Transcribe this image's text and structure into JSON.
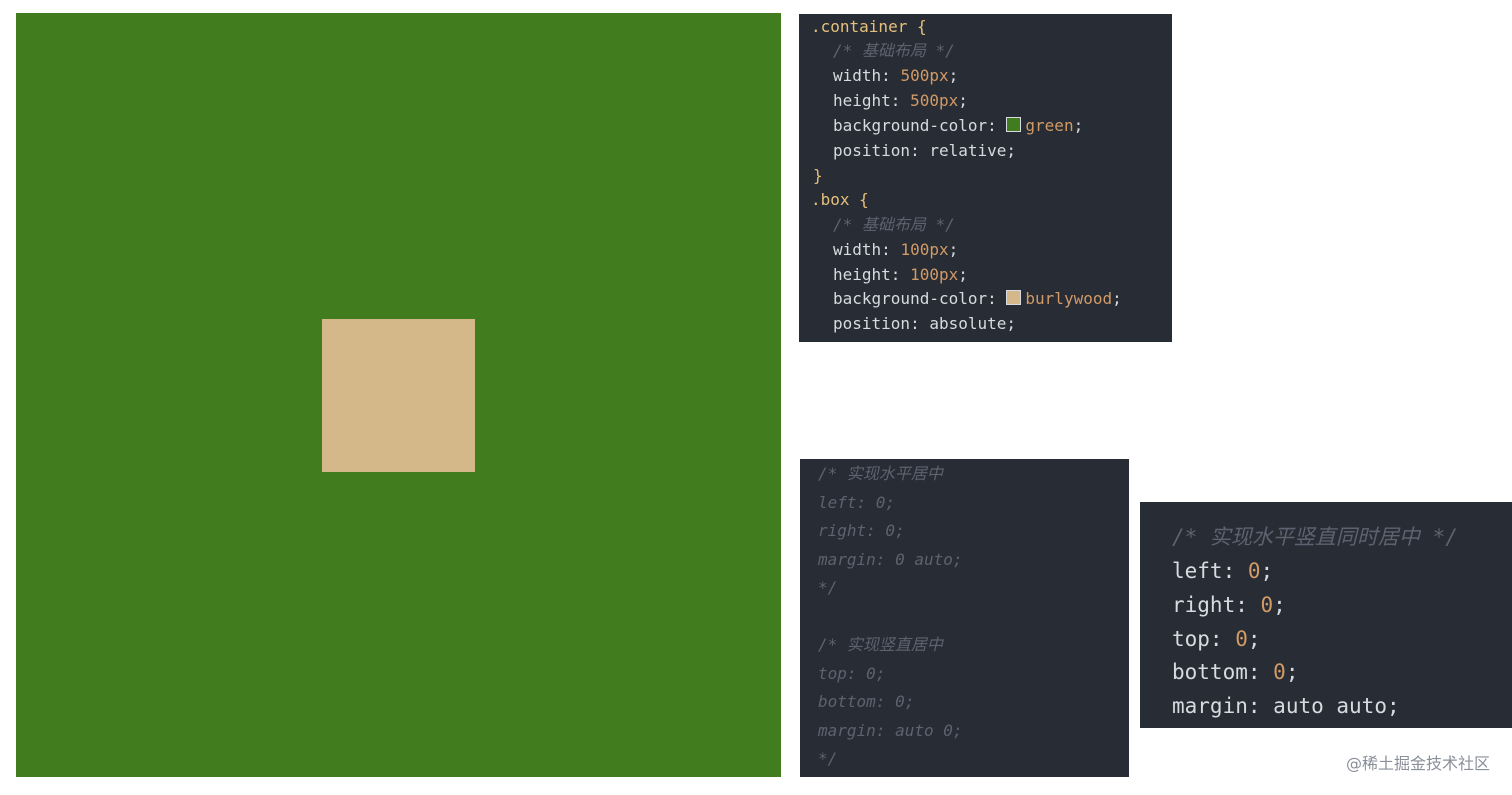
{
  "demo": {
    "container_color": "#417d1f",
    "box_color": "#d4b88a"
  },
  "code_top": {
    "l1": {
      "selector": ".container",
      "brace": " {"
    },
    "l2": {
      "comment": "/* 基础布局 */"
    },
    "l3": {
      "prop": "width:",
      "val": "500px",
      "end": ";"
    },
    "l4": {
      "prop": "height:",
      "val": "500px",
      "end": ";"
    },
    "l5": {
      "prop": "background-color:",
      "swatch": "#417d1f",
      "val": "green",
      "end": ";"
    },
    "l6": {
      "prop": "position:",
      "val": "relative",
      "end": ";"
    },
    "l7": {
      "brace": "}"
    },
    "l8": {
      "selector": ".box",
      "brace": " {"
    },
    "l9": {
      "comment": "/* 基础布局 */"
    },
    "l10": {
      "prop": "width:",
      "val": "100px",
      "end": ";"
    },
    "l11": {
      "prop": "height:",
      "val": "100px",
      "end": ";"
    },
    "l12": {
      "prop": "background-color:",
      "swatch": "#d4b88a",
      "val": "burlywood",
      "end": ";"
    },
    "l13": {
      "prop": "position:",
      "val": "absolute",
      "end": ";"
    }
  },
  "code_bottom": {
    "l1": "/* 实现水平居中",
    "l2": "left: 0;",
    "l3": "right: 0;",
    "l4": "margin: 0 auto;",
    "l5": "*/",
    "l6": "/* 实现竖直居中",
    "l7": "top: 0;",
    "l8": "bottom: 0;",
    "l9": "margin: auto 0;",
    "l10": "*/"
  },
  "code_right": {
    "l1": {
      "comment": "/* 实现水平竖直同时居中 */"
    },
    "l2": {
      "prop": "left:",
      "val": "0",
      "end": ";"
    },
    "l3": {
      "prop": "right:",
      "val": "0",
      "end": ";"
    },
    "l4": {
      "prop": "top:",
      "val": "0",
      "end": ";"
    },
    "l5": {
      "prop": "bottom:",
      "val": "0",
      "end": ";"
    },
    "l6": {
      "prop": "margin:",
      "val": "auto auto",
      "end": ";"
    }
  },
  "watermark": "@稀土掘金技术社区"
}
